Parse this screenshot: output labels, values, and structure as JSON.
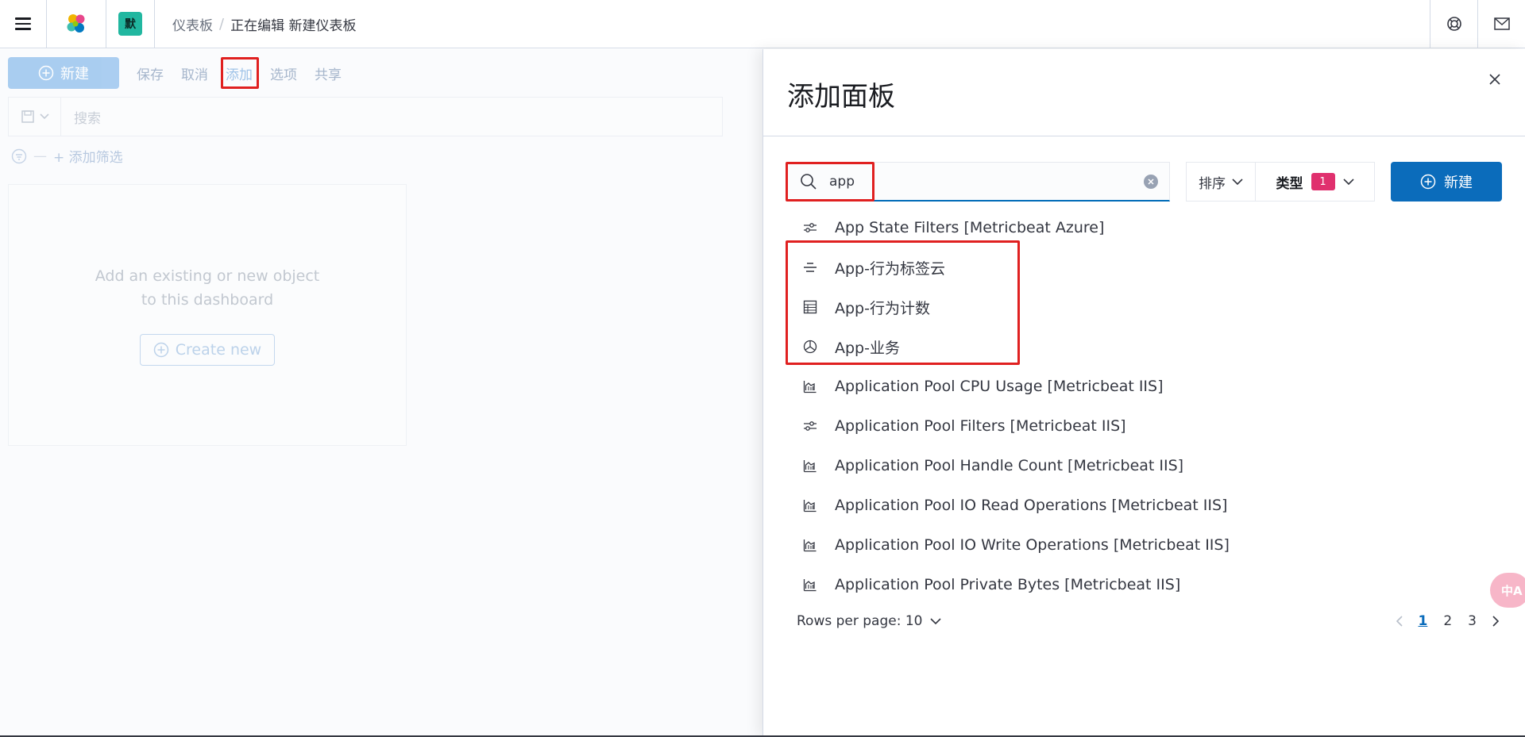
{
  "header": {
    "space_initial": "默",
    "breadcrumb_parent": "仪表板",
    "breadcrumb_separator": "/",
    "breadcrumb_current": "正在编辑 新建仪表板"
  },
  "toolbar": {
    "new_label": "新建",
    "save_label": "保存",
    "cancel_label": "取消",
    "add_label": "添加",
    "options_label": "选项",
    "share_label": "共享"
  },
  "query": {
    "placeholder": "搜索",
    "add_filter_label": "+ 添加筛选"
  },
  "empty_panel": {
    "message_line1": "Add an existing or new object",
    "message_line2": "to this dashboard",
    "create_new_label": "Create new"
  },
  "flyout": {
    "title": "添加面板",
    "search_value": "app",
    "sort_label": "排序",
    "type_label": "类型",
    "type_count": "1",
    "create_label": "新建",
    "results": [
      {
        "icon": "controls-icon",
        "label": "App State Filters [Metricbeat Azure]"
      },
      {
        "icon": "tagcloud-icon",
        "label": "App-行为标签云"
      },
      {
        "icon": "table-icon",
        "label": "App-行为计数"
      },
      {
        "icon": "pie-icon",
        "label": "App-业务"
      },
      {
        "icon": "area-chart-icon",
        "label": "Application Pool CPU Usage [Metricbeat IIS]"
      },
      {
        "icon": "controls-icon",
        "label": "Application Pool Filters [Metricbeat IIS]"
      },
      {
        "icon": "area-chart-icon",
        "label": "Application Pool Handle Count [Metricbeat IIS]"
      },
      {
        "icon": "area-chart-icon",
        "label": "Application Pool IO Read Operations [Metricbeat IIS]"
      },
      {
        "icon": "area-chart-icon",
        "label": "Application Pool IO Write Operations [Metricbeat IIS]"
      },
      {
        "icon": "area-chart-icon",
        "label": "Application Pool Private Bytes [Metricbeat IIS]"
      }
    ],
    "rows_per_page_label": "Rows per page: 10",
    "pages": [
      "1",
      "2",
      "3"
    ],
    "active_page": "1"
  },
  "misc": {
    "translate_label": "中A"
  },
  "colors": {
    "primary": "#0b6cbb",
    "badge": "#e0306e",
    "highlight_box": "#e02020",
    "space_badge": "#21b7a0"
  }
}
